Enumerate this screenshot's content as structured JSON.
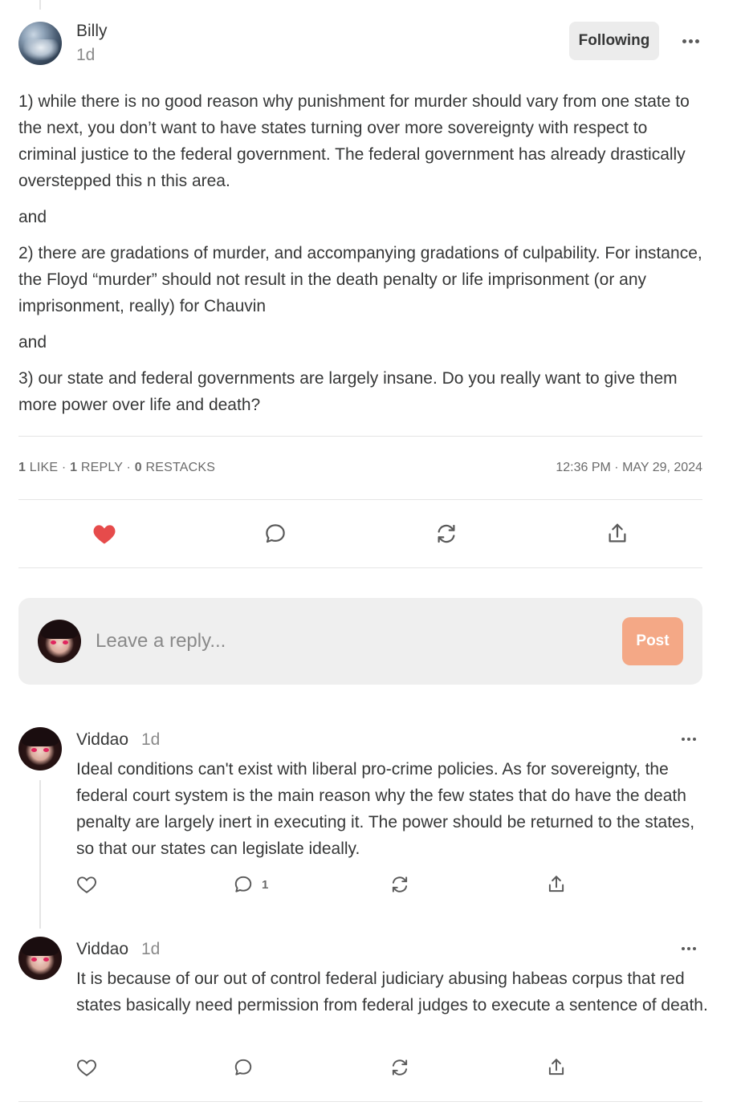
{
  "main_comment": {
    "author": "Billy",
    "time": "1d",
    "follow_label": "Following",
    "paragraphs": [
      "1) while there is no good reason why punishment for murder should vary from one state to the next, you don’t want to have states turning over more sovereignty with respect to criminal justice to the federal government. The federal government has already drastically overstepped this n this area.",
      "and",
      "2) there are gradations of murder, and accompanying gradations of culpability. For instance, the Floyd “murder” should not result in the death penalty or life imprisonment (or any imprisonment, really) for Chauvin",
      "and",
      "3) our state and federal governments are largely insane. Do you really want to give them more power over life and death?"
    ],
    "stats": {
      "likes_count": "1",
      "likes_label": "LIKE",
      "replies_count": "1",
      "replies_label": "REPLY",
      "restacks_count": "0",
      "restacks_label": "RESTACKS",
      "separator": "·"
    },
    "timestamp": "12:36 PM · MAY 29, 2024",
    "liked": true
  },
  "reply_box": {
    "placeholder": "Leave a reply...",
    "post_label": "Post"
  },
  "replies": [
    {
      "author": "Viddao",
      "time": "1d",
      "text": "Ideal conditions can't exist with liberal pro-crime policies. As for sovereignty, the federal court system is the main reason why the few states that do have the death penalty are largely inert in executing it. The power should be returned to the states, so that our states can legislate ideally.",
      "reply_count": "1"
    },
    {
      "author": "Viddao",
      "time": "1d",
      "text": "It is because of our out of control federal judiciary abusing habeas corpus that red states basically need permission from federal judges to execute a sentence of death.",
      "reply_count": ""
    }
  ],
  "colors": {
    "like_active": "#e64b4b",
    "post_button": "#f4a886",
    "icon": "#5a5a5a"
  },
  "icons": {
    "like": "heart-icon",
    "comment": "comment-bubble-icon",
    "restack": "restack-icon",
    "share": "share-icon",
    "more": "more-dots-icon"
  }
}
